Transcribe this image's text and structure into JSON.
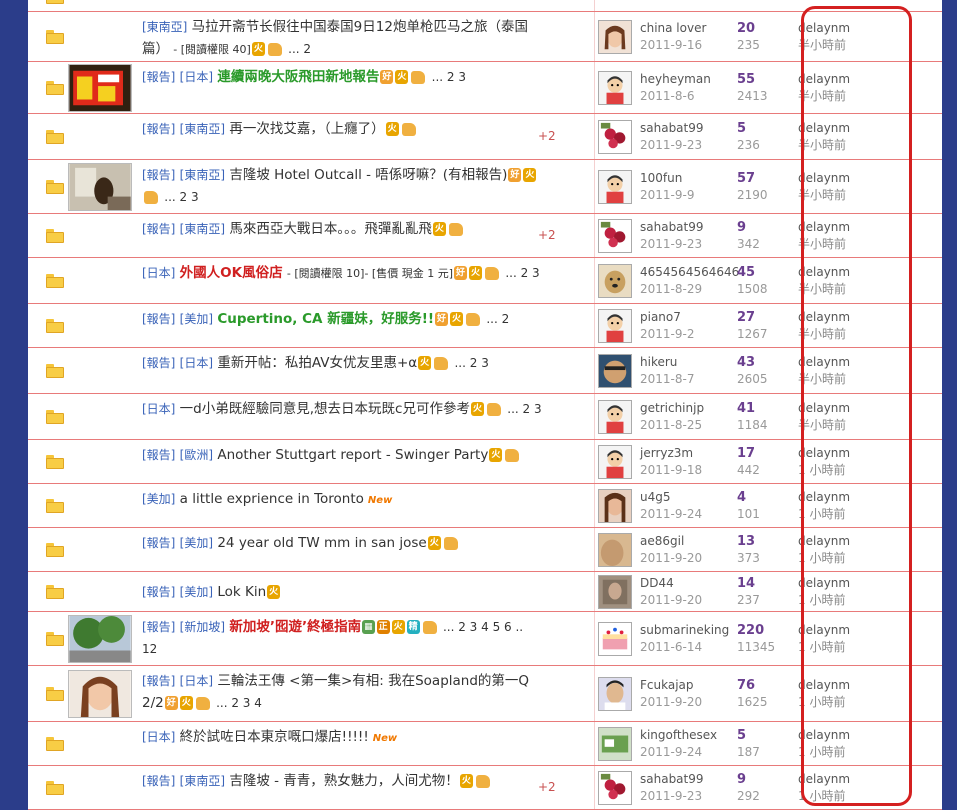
{
  "highlight_color": "#d42020",
  "top_partial": {
    "pages": "2",
    "author": "",
    "date": ""
  },
  "threads": [
    {
      "thumb": null,
      "tags": [
        "東南亞"
      ],
      "title": "马拉开斋节长假往中国泰国9日12炮单枪匹马之旅（泰国篇）",
      "style": "normal",
      "extra": "- [閱讀權限 40]",
      "badges": [
        "hot"
      ],
      "thumbup": true,
      "pages": "... 2",
      "plus": "",
      "avatar": "girl",
      "author": "china lover",
      "date": "2011-9-16",
      "replies": "20",
      "views": "235",
      "last_user": "delaynm",
      "last_time": "半小時前"
    },
    {
      "thumb": "sign",
      "tags": [
        "報告",
        "日本"
      ],
      "title": "連續兩晚大阪飛田新地報告",
      "style": "green",
      "extra": "",
      "badges": [
        "good",
        "hot"
      ],
      "thumbup": true,
      "pages": "... 2 3",
      "plus": "",
      "avatar": "default",
      "author": "heyheyman",
      "date": "2011-8-6",
      "replies": "55",
      "views": "2413",
      "last_user": "delaynm",
      "last_time": "半小時前"
    },
    {
      "thumb": null,
      "tags": [
        "報告",
        "東南亞"
      ],
      "title": "再一次找艾嘉，（上癮了）",
      "style": "normal",
      "extra": "",
      "badges": [
        "hot"
      ],
      "thumbup": true,
      "pages": "",
      "plus": "+2",
      "avatar": "flower",
      "author": "sahabat99",
      "date": "2011-9-23",
      "replies": "5",
      "views": "236",
      "last_user": "delaynm",
      "last_time": "半小時前"
    },
    {
      "thumb": "room",
      "tags": [
        "報告",
        "東南亞"
      ],
      "title": "吉隆坡 Hotel Outcall - 唔係呀嘛？(有相報告)",
      "style": "normal",
      "extra": "",
      "badges": [
        "good",
        "hot"
      ],
      "thumbup": true,
      "pages": "... 2 3",
      "plus": "",
      "avatar": "default",
      "author": "100fun",
      "date": "2011-9-9",
      "replies": "57",
      "views": "2190",
      "last_user": "delaynm",
      "last_time": "半小時前"
    },
    {
      "thumb": null,
      "tags": [
        "報告",
        "東南亞"
      ],
      "title": "馬來西亞大戰日本。。。飛彈亂亂飛",
      "style": "normal",
      "extra": "",
      "badges": [
        "hot"
      ],
      "thumbup": true,
      "pages": "",
      "plus": "+2",
      "avatar": "flower",
      "author": "sahabat99",
      "date": "2011-9-23",
      "replies": "9",
      "views": "342",
      "last_user": "delaynm",
      "last_time": "半小時前"
    },
    {
      "thumb": null,
      "tags": [
        "日本"
      ],
      "title": "外國人OK風俗店",
      "style": "red",
      "extra": "- [閱讀權限 10]- [售價 現金 1 元]",
      "badges": [
        "good",
        "hot"
      ],
      "thumbup": true,
      "pages": "... 2 3",
      "plus": "",
      "avatar": "dog",
      "author": "4654564564646",
      "date": "2011-8-29",
      "replies": "45",
      "views": "1508",
      "last_user": "delaynm",
      "last_time": "半小時前"
    },
    {
      "thumb": null,
      "tags": [
        "報告",
        "美加"
      ],
      "title": "Cupertino, CA 新疆妹，好服务!!",
      "style": "green",
      "extra": "",
      "badges": [
        "good",
        "hot"
      ],
      "thumbup": true,
      "pages": "... 2",
      "plus": "",
      "avatar": "default",
      "author": "piano7",
      "date": "2011-9-2",
      "replies": "27",
      "views": "1267",
      "last_user": "delaynm",
      "last_time": "半小時前"
    },
    {
      "thumb": null,
      "tags": [
        "報告",
        "日本"
      ],
      "title": "重新开帖：私拍AV女优友里惠+α",
      "style": "normal",
      "extra": "",
      "badges": [
        "hot"
      ],
      "thumbup": true,
      "pages": "... 2 3",
      "plus": "",
      "avatar": "face",
      "author": "hikeru",
      "date": "2011-8-7",
      "replies": "43",
      "views": "2605",
      "last_user": "delaynm",
      "last_time": "半小時前"
    },
    {
      "thumb": null,
      "tags": [
        "日本"
      ],
      "title": "一d小弟既經驗同意見,想去日本玩既c兄可作參考",
      "style": "normal",
      "extra": "",
      "badges": [
        "hot"
      ],
      "thumbup": true,
      "pages": "... 2 3",
      "plus": "",
      "avatar": "default",
      "author": "getrichinjp",
      "date": "2011-8-25",
      "replies": "41",
      "views": "1184",
      "last_user": "delaynm",
      "last_time": "半小時前"
    },
    {
      "thumb": null,
      "tags": [
        "報告",
        "歐洲"
      ],
      "title": "Another Stuttgart report - Swinger Party",
      "style": "normal",
      "extra": "",
      "badges": [
        "hot"
      ],
      "thumbup": true,
      "pages": "",
      "plus": "",
      "avatar": "default",
      "author": "jerryz3m",
      "date": "2011-9-18",
      "replies": "17",
      "views": "442",
      "last_user": "delaynm",
      "last_time": "1 小時前"
    },
    {
      "thumb": null,
      "tags": [
        "美加"
      ],
      "title": "a little exprience in Toronto",
      "style": "normal",
      "extra": "",
      "badges": [],
      "thumbup": false,
      "new": "New",
      "pages": "",
      "plus": "",
      "avatar": "woman",
      "author": "u4g5",
      "date": "2011-9-24",
      "replies": "4",
      "views": "101",
      "last_user": "delaynm",
      "last_time": "1 小時前"
    },
    {
      "thumb": null,
      "tags": [
        "報告",
        "美加"
      ],
      "title": "24 year old TW mm in san jose",
      "style": "normal",
      "extra": "",
      "badges": [
        "hot"
      ],
      "thumbup": true,
      "pages": "",
      "plus": "",
      "avatar": "skin",
      "author": "ae86gil",
      "date": "2011-9-20",
      "replies": "13",
      "views": "373",
      "last_user": "delaynm",
      "last_time": "1 小時前"
    },
    {
      "thumb": null,
      "tags": [
        "報告",
        "美加"
      ],
      "title": "Lok Kin",
      "style": "normal",
      "extra": "",
      "badges": [
        "hot"
      ],
      "thumbup": false,
      "pages": "",
      "plus": "",
      "avatar": "photo",
      "author": "DD44",
      "date": "2011-9-20",
      "replies": "14",
      "views": "237",
      "last_user": "delaynm",
      "last_time": "1 小時前"
    },
    {
      "thumb": "tree",
      "tags": [
        "報告",
        "新加坡"
      ],
      "title": "新加坡’囮遊’終極指南",
      "style": "red",
      "extra": "",
      "badges": [
        "img",
        "zheng",
        "hot",
        "jing"
      ],
      "thumbup": true,
      "pages": "... 2 3 4 5 6 .. 12",
      "plus": "",
      "avatar": "cake",
      "author": "submarineking",
      "date": "2011-6-14",
      "replies": "220",
      "views": "11345",
      "last_user": "delaynm",
      "last_time": "1 小時前"
    },
    {
      "thumb": "girl",
      "tags": [
        "報告",
        "日本"
      ],
      "title": "三輪法王傳 <第一集>有相: 我在Soapland的第一Q 2/2",
      "style": "normal",
      "extra": "",
      "badges": [
        "good",
        "hot"
      ],
      "thumbup": true,
      "pages": "... 2 3 4",
      "plus": "",
      "avatar": "man",
      "author": "Fcukajap",
      "date": "2011-9-20",
      "replies": "76",
      "views": "1625",
      "last_user": "delaynm",
      "last_time": "1 小時前"
    },
    {
      "thumb": null,
      "tags": [
        "日本"
      ],
      "title": "終於試咗日本東京嘅口爆店!!!!!",
      "style": "normal",
      "extra": "",
      "badges": [],
      "thumbup": false,
      "new": "New",
      "pages": "",
      "plus": "",
      "avatar": "green",
      "author": "kingofthesex",
      "date": "2011-9-24",
      "replies": "5",
      "views": "187",
      "last_user": "delaynm",
      "last_time": "1 小時前"
    },
    {
      "thumb": null,
      "tags": [
        "報告",
        "東南亞"
      ],
      "title": "吉隆坡 - 青青，熟女魅力，人间尤物！",
      "style": "normal",
      "extra": "",
      "badges": [
        "hot"
      ],
      "thumbup": true,
      "pages": "",
      "plus": "+2",
      "avatar": "flower",
      "author": "sahabat99",
      "date": "2011-9-23",
      "replies": "9",
      "views": "292",
      "last_user": "delaynm",
      "last_time": "1 小時前"
    }
  ],
  "badge_labels": {
    "hot": "火",
    "good": "好",
    "zheng": "正",
    "jing": "精",
    "img": "▦"
  }
}
